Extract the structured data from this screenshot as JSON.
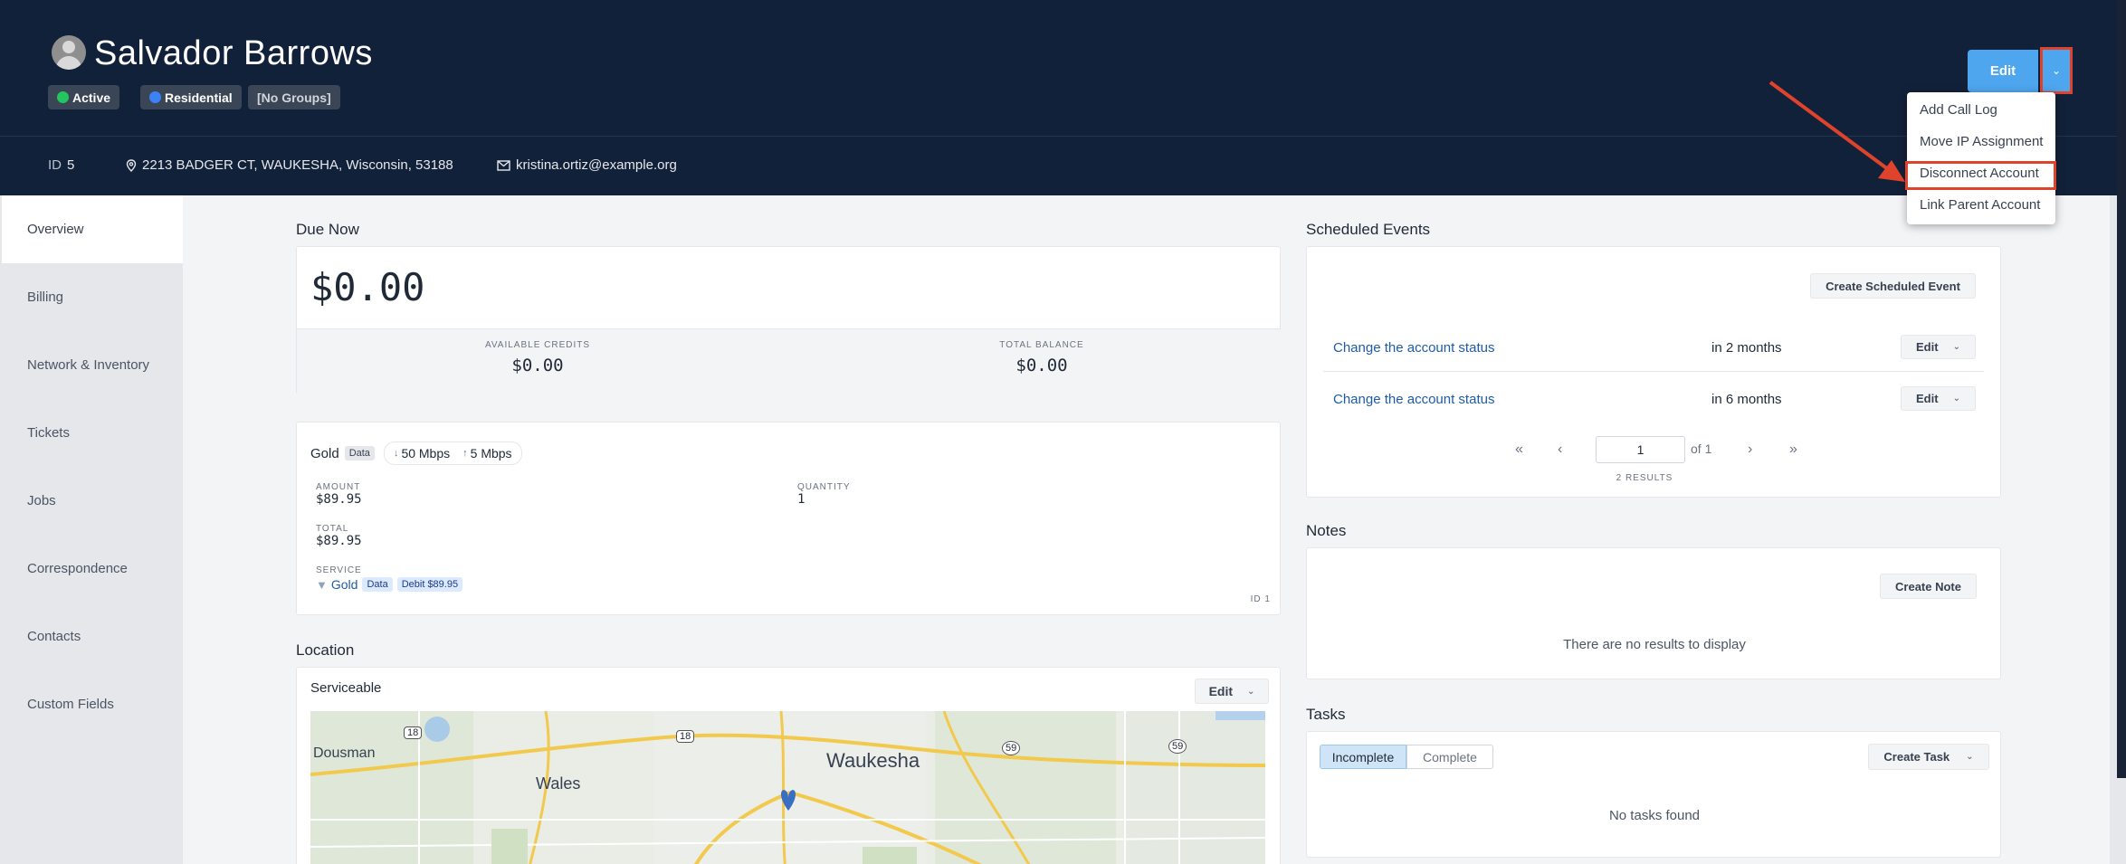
{
  "header": {
    "name": "Salvador Barrows",
    "badges": [
      {
        "label": "Active",
        "dot_color": "#22c55e"
      },
      {
        "label": "Residential",
        "dot_color": "#3b82f6"
      },
      {
        "label": "[No Groups]"
      }
    ],
    "edit_label": "Edit",
    "id_label": "ID",
    "id_value": "5",
    "address": "2213 BADGER CT, WAUKESHA, Wisconsin, 53188",
    "email": "kristina.ortiz@example.org"
  },
  "dropdown": {
    "items": [
      "Add Call Log",
      "Move IP Assignment",
      "Disconnect Account",
      "Link Parent Account"
    ],
    "highlighted": "Disconnect Account"
  },
  "sidebar": {
    "items": [
      "Overview",
      "Billing",
      "Network & Inventory",
      "Tickets",
      "Jobs",
      "Correspondence",
      "Contacts",
      "Custom Fields"
    ],
    "active": "Overview"
  },
  "due_now": {
    "title": "Due Now",
    "amount": "$0.00",
    "available_credits_label": "AVAILABLE CREDITS",
    "available_credits": "$0.00",
    "total_balance_label": "TOTAL BALANCE",
    "total_balance": "$0.00"
  },
  "service": {
    "plan": "Gold",
    "plan_tag": "Data",
    "down_speed": "50 Mbps",
    "up_speed": "5 Mbps",
    "amount_label": "AMOUNT",
    "amount": "$89.95",
    "quantity_label": "QUANTITY",
    "quantity": "1",
    "total_label": "TOTAL",
    "total": "$89.95",
    "service_label": "SERVICE",
    "service_name": "Gold",
    "service_tag": "Data",
    "debit_tag": "Debit $89.95",
    "id_text": "ID 1"
  },
  "location": {
    "title": "Location",
    "status": "Serviceable",
    "edit_label": "Edit",
    "map_labels": [
      "Dousman",
      "Wales",
      "Waukesha",
      "18",
      "18",
      "59",
      "59"
    ]
  },
  "scheduled": {
    "title": "Scheduled Events",
    "create_label": "Create Scheduled Event",
    "events": [
      {
        "name": "Change the account status",
        "when": "in 2 months"
      },
      {
        "name": "Change the account status",
        "when": "in 6 months"
      }
    ],
    "edit_label": "Edit",
    "page": "1",
    "of_text": "of 1",
    "results": "2 RESULTS"
  },
  "notes": {
    "title": "Notes",
    "create_label": "Create Note",
    "empty": "There are no results to display"
  },
  "tasks": {
    "title": "Tasks",
    "tab_incomplete": "Incomplete",
    "tab_complete": "Complete",
    "create_label": "Create Task",
    "empty": "No tasks found"
  },
  "colors": {
    "header_bg": "#12213a",
    "primary": "#4ea6ef",
    "annotation": "#e0432c",
    "link": "#1e5ba8"
  }
}
